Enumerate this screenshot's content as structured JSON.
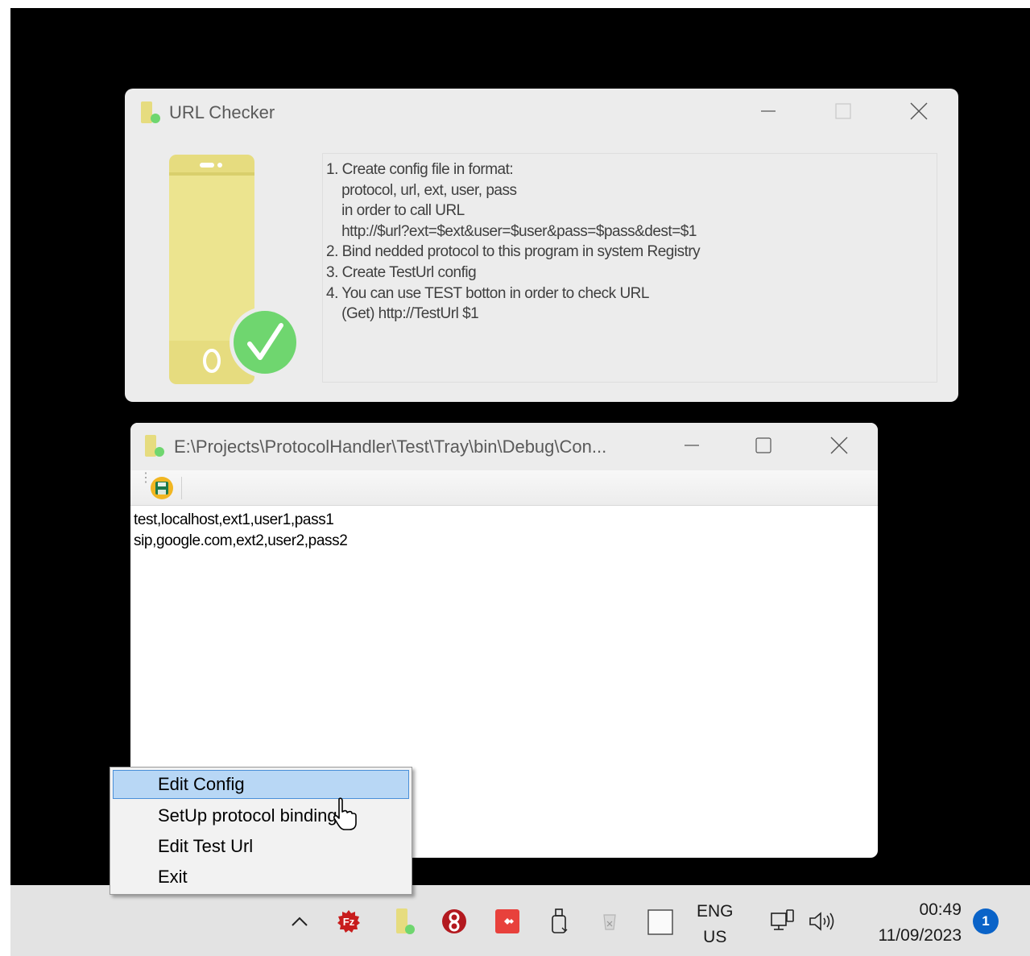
{
  "window_main": {
    "title": "URL Checker",
    "icon": "app-phone-icon",
    "instructions": [
      "1. Create config file in format:",
      "    protocol, url, ext, user, pass",
      "    in order to call URL",
      "    http://$url?ext=$ext&user=$user&pass=$pass&dest=$1",
      "2. Bind nedded protocol to this program in system Registry",
      "3. Create TestUrl config",
      "4. You can use TEST botton in order to check URL",
      "    (Get) http://TestUrl $1"
    ]
  },
  "window_editor": {
    "title": "E:\\Projects\\ProtocolHandler\\Test\\Tray\\bin\\Debug\\Con...",
    "lines": [
      "test,localhost,ext1,user1,pass1",
      "sip,google.com,ext2,user2,pass2"
    ]
  },
  "context_menu": {
    "items": [
      "Edit Config",
      "SetUp protocol binding",
      "Edit Test Url",
      "Exit"
    ],
    "highlighted_index": 0
  },
  "taskbar": {
    "lang_top": "ENG",
    "lang_bottom": "US",
    "time": "00:49",
    "date": "11/09/2023",
    "notification_count": "1"
  },
  "colors": {
    "phone_yellow": "#e6dc7f",
    "check_green": "#6fd66f",
    "menu_highlight": "#b8d7f5",
    "notif_blue": "#0a63c8"
  }
}
